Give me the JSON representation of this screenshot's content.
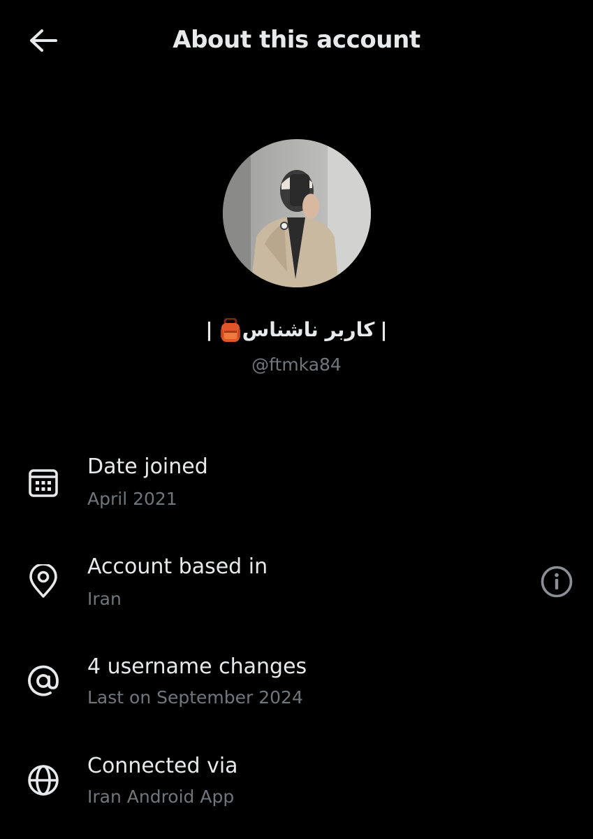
{
  "header": {
    "title": "About this account",
    "back_icon": "arrow-left-icon"
  },
  "profile": {
    "display_name": "| کاربر ناشناس🎒 |",
    "display_name_parts": {
      "bar_left": "|",
      "name": "کاربر ناشناس",
      "emoji_icon": "backpack-icon",
      "bar_right": "|"
    },
    "handle": "@ftmka84",
    "avatar_icon": "profile-photo"
  },
  "rows": [
    {
      "icon": "calendar-icon",
      "label": "Date joined",
      "value": "April 2021"
    },
    {
      "icon": "location-pin-icon",
      "label": "Account based in",
      "value": "Iran",
      "action_icon": "info-icon"
    },
    {
      "icon": "at-sign-icon",
      "label": "4 username changes",
      "value": "Last on September 2024"
    },
    {
      "icon": "globe-icon",
      "label": "Connected via",
      "value": "Iran Android App"
    }
  ],
  "colors": {
    "background": "#000000",
    "primary_text": "#e7e9ea",
    "secondary_text": "#71767b"
  }
}
